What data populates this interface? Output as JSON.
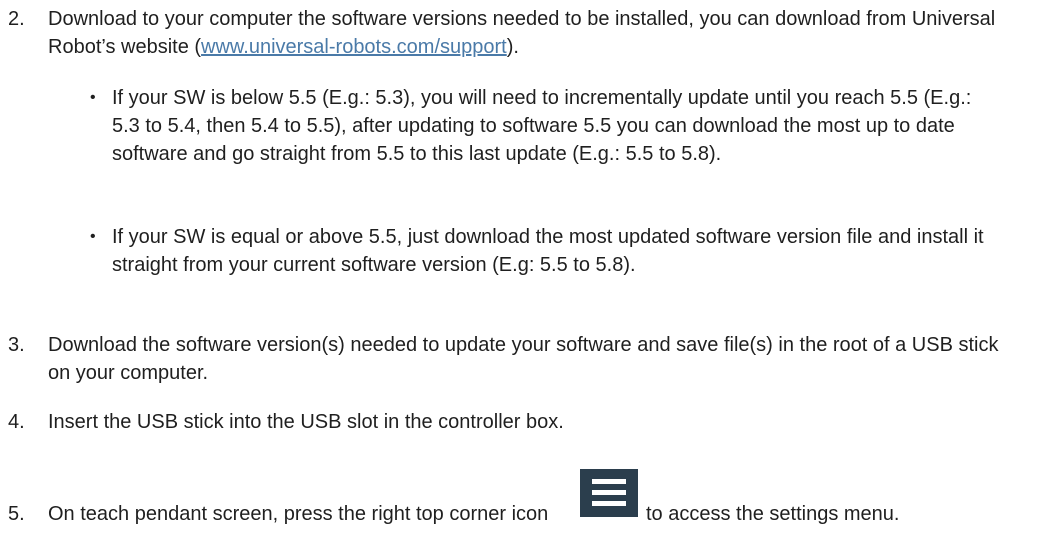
{
  "steps": [
    {
      "number": "2.",
      "text_before_link": "Download to your computer the software versions needed to be installed, you can download from Universal Robot’s website (",
      "link_text": "www.universal-robots.com/support",
      "text_after_link": ").",
      "bullets": [
        "If your SW is below 5.5 (E.g.: 5.3), you will need to incrementally update until you reach 5.5 (E.g.: 5.3 to 5.4, then 5.4 to 5.5), after updating to software 5.5 you can download the most up to date software and go straight from 5.5 to this last update (E.g.: 5.5 to 5.8).",
        "If your SW is equal or above 5.5, just download the most updated software version file and install it straight from your current software version (E.g: 5.5 to 5.8)."
      ]
    },
    {
      "number": "3.",
      "text": "Download the software version(s) needed to update your software and save file(s) in the root of a USB stick on your computer."
    },
    {
      "number": "4.",
      "text": "Insert the USB stick into the USB slot in the controller box."
    },
    {
      "number": "5.",
      "text_before_icon": "On teach pendant screen, press the right top corner icon",
      "icon": "hamburger-menu-icon",
      "text_after_icon": "to access the settings menu."
    }
  ],
  "colors": {
    "link": "#4a7aa8",
    "icon_bg": "#2b3e4d",
    "text": "#1f1f1f"
  }
}
